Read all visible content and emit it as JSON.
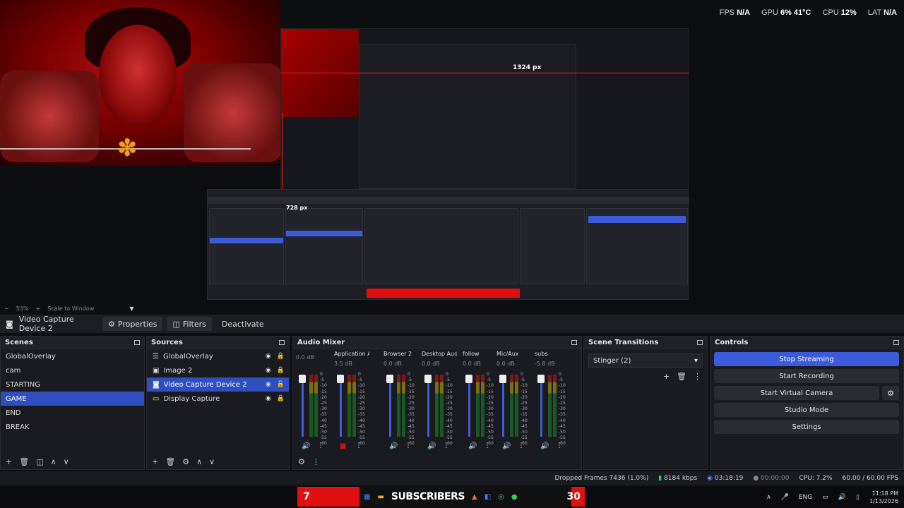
{
  "preview": {
    "stats": {
      "fps_label": "FPS",
      "fps_value": "N/A",
      "gpu_label": "GPU",
      "gpu_value": "6% 41°C",
      "cpu_label": "CPU",
      "cpu_value": "12%",
      "lat_label": "LAT",
      "lat_value": "N/A"
    },
    "nested_dim_width": "1324 px",
    "nested_dim_height": "728 px",
    "zoom": {
      "minus": "−",
      "percent": "53%",
      "plus": "+",
      "mode": "Scale to Window"
    }
  },
  "source_toolbar": {
    "source_name": "Video Capture Device 2",
    "properties_label": "Properties",
    "filters_label": "Filters",
    "deactivate_label": "Deactivate"
  },
  "scenes": {
    "title": "Scenes",
    "items": [
      "GlobalOverlay",
      "cam",
      "STARTING",
      "GAME",
      "END",
      "BREAK"
    ],
    "selected": "GAME"
  },
  "sources": {
    "title": "Sources",
    "items": [
      "GlobalOverlay",
      "Image 2",
      "Video Capture Device 2",
      "Display Capture"
    ],
    "selected": "Video Capture Device 2"
  },
  "mixer": {
    "title": "Audio Mixer",
    "channels": [
      {
        "name": "",
        "db": "0.0 dB"
      },
      {
        "name": "Application Audio C",
        "db": "3.5 dB"
      },
      {
        "name": "Browser 2",
        "db": "0.0 dB"
      },
      {
        "name": "Desktop Audio",
        "db": "0.0 dB"
      },
      {
        "name": "follow",
        "db": "0.0 dB"
      },
      {
        "name": "Mic/Aux",
        "db": "0.0 dB"
      },
      {
        "name": "subs",
        "db": "-5.8 dB"
      }
    ],
    "scale": [
      "0",
      "-5",
      "-10",
      "-15",
      "-20",
      "-25",
      "-30",
      "-35",
      "-40",
      "-45",
      "-50",
      "-55",
      "-60"
    ]
  },
  "transitions": {
    "title": "Scene Transitions",
    "selected": "Stinger (2)"
  },
  "controls": {
    "title": "Controls",
    "stop_streaming": "Stop Streaming",
    "start_recording": "Start Recording",
    "start_virtual_camera": "Start Virtual Camera",
    "studio_mode": "Studio Mode",
    "settings": "Settings"
  },
  "status": {
    "dropped_frames": "Dropped Frames 7436 (1.0%)",
    "bitrate": "8184 kbps",
    "stream_time": "03:18:19",
    "record_time": "00:00:00",
    "cpu": "CPU: 7.2%",
    "fps": "60.00 / 60.00 FPS"
  },
  "taskbar": {
    "ticker_left": "7",
    "ticker_text": "SUBSCRIBERS",
    "ticker_right": "30",
    "lang": "ENG",
    "time": "11:18 PM",
    "date": "1/13/2026"
  }
}
